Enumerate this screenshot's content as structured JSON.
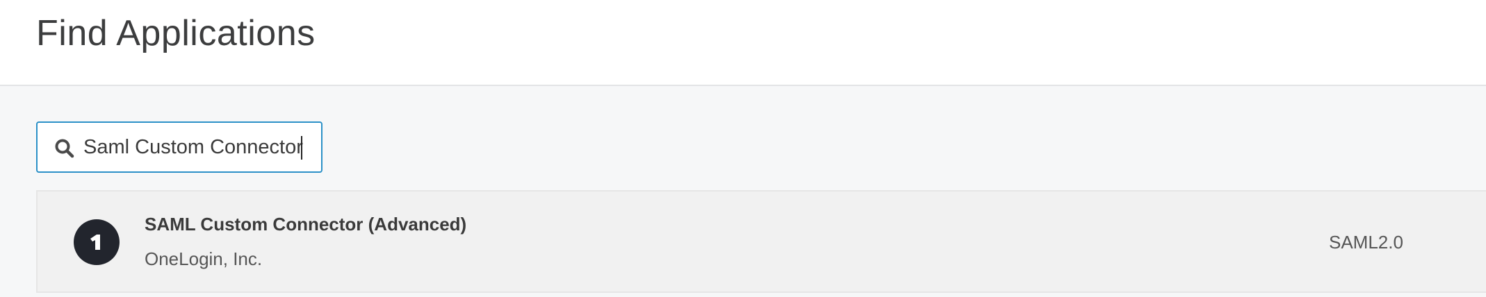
{
  "header": {
    "title": "Find Applications"
  },
  "search": {
    "icon": "search-icon",
    "value": "Saml Custom Connector",
    "border_color": "#2b90c7"
  },
  "results": [
    {
      "name": "SAML Custom Connector (Advanced)",
      "vendor": "OneLogin, Inc.",
      "protocol": "SAML2.0",
      "logo_icon": "onelogin-logo-icon",
      "logo_color": "#22252d"
    }
  ]
}
